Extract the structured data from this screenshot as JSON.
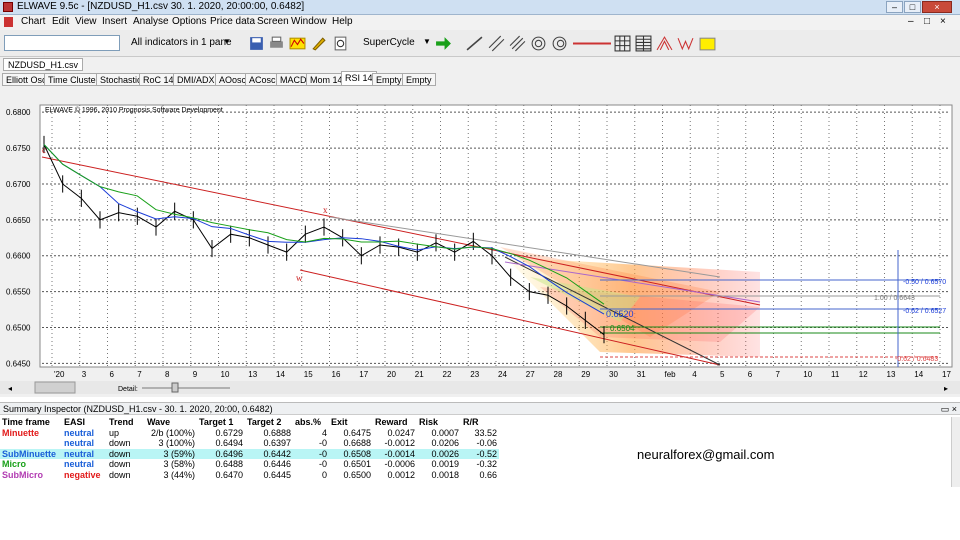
{
  "window": {
    "title": "ELWAVE 9.5c - [NZDUSD_H1.csv  30. 1. 2020, 20:00:00, 0.6482]",
    "minimize": "–",
    "maximize": "□",
    "close": "×"
  },
  "menu": {
    "items": [
      "Chart",
      "Edit",
      "View",
      "Insert",
      "Analyse",
      "Options",
      "Price data",
      "Screen",
      "Window",
      "Help"
    ],
    "doc_controls": [
      "–",
      "□",
      "×"
    ]
  },
  "toolbar": {
    "search_value": "",
    "indicators_label": "All indicators in 1 pane",
    "cycle_label": "SuperCycle"
  },
  "tabs": {
    "file": "NZDUSD_H1.csv",
    "indicators": [
      "Elliott Osc",
      "Time Clusters",
      "Stochastic",
      "RoC 14",
      "DMI/ADX",
      "AOosc",
      "ACosc",
      "MACD",
      "Mom 14",
      "RSI 14",
      "Empty",
      "Empty"
    ],
    "active_index": 9
  },
  "chart": {
    "copyright": "ELWAVE © 1996, 2010 Prognosis Software Development",
    "wave_labels": [
      "c",
      "x",
      "w"
    ],
    "price_marks": [
      "0.6520",
      "0.6504"
    ],
    "target_labels": [
      "-0.50 / 0.6570",
      "-0.62 / 0.6527",
      "1.00 / 0.6643",
      "-0.62 / 0.6483"
    ],
    "scroll_detail_label": "Detail:",
    "colors": {
      "price": "#000000",
      "ma_blue": "#1a3cd8",
      "ma_green": "#19a019",
      "channel": "#cc2020",
      "projection": "#ff8a00"
    }
  },
  "chart_data": {
    "type": "line",
    "title": "NZDUSD_H1",
    "y_ticks": [
      "0.6800",
      "0.6750",
      "0.6700",
      "0.6650",
      "0.6600",
      "0.6550",
      "0.6500",
      "0.6450"
    ],
    "ylim": [
      0.6445,
      0.681
    ],
    "x_ticks": [
      "'20",
      "3",
      "6",
      "7",
      "8",
      "9",
      "10",
      "13",
      "14",
      "15",
      "16",
      "17",
      "20",
      "21",
      "22",
      "23",
      "24",
      "27",
      "28",
      "29",
      "30",
      "31",
      "feb",
      "4",
      "5",
      "6",
      "7",
      "10",
      "11",
      "12",
      "13",
      "14",
      "17"
    ],
    "series": [
      {
        "name": "",
        "values": [
          0.6755,
          0.67,
          0.668,
          0.665,
          0.666,
          0.6655,
          0.664,
          0.6662,
          0.665,
          0.661,
          0.663,
          0.6625,
          0.6615,
          0.6605,
          0.663,
          0.664,
          0.6625,
          0.66,
          0.6615,
          0.6612,
          0.6605,
          0.6618,
          0.6605,
          0.662,
          0.66,
          0.657,
          0.655,
          0.6545,
          0.653,
          0.651,
          0.649
        ]
      }
    ]
  },
  "summary": {
    "title": "Summary Inspector (NZDUSD_H1.csv - 30. 1. 2020, 20:00, 0.6482)",
    "columns": [
      "Time frame",
      "EASI",
      "Trend",
      "Wave",
      "Target 1",
      "Target 2",
      "abs.%",
      "Exit",
      "Reward",
      "Risk",
      "R/R"
    ],
    "rows": [
      [
        "Minuette",
        "neutral",
        "up",
        "2/b (100%)",
        "0.6729",
        "0.6888",
        "4",
        "0.6475",
        "0.0247",
        "0.0007",
        "33.52"
      ],
      [
        "",
        "neutral",
        "down",
        "3 (100%)",
        "0.6494",
        "0.6397",
        "-0",
        "0.6688",
        "-0.0012",
        "0.0206",
        "-0.06"
      ],
      [
        "SubMinuette",
        "neutral",
        "down",
        "3 (59%)",
        "0.6496",
        "0.6442",
        "-0",
        "0.6508",
        "-0.0014",
        "0.0026",
        "-0.52"
      ],
      [
        "Micro",
        "neutral",
        "down",
        "3 (58%)",
        "0.6488",
        "0.6446",
        "-0",
        "0.6501",
        "-0.0006",
        "0.0019",
        "-0.32"
      ],
      [
        "SubMicro",
        "negative",
        "down",
        "3 (44%)",
        "0.6470",
        "0.6445",
        "0",
        "0.6500",
        "0.0012",
        "0.0018",
        "0.66"
      ]
    ],
    "row_colors": [
      "#e21a1a",
      "#e21a1a",
      "#1a5fd8",
      "#19a019",
      "#b23cb2"
    ],
    "email": "neuralforex@gmail.com"
  }
}
